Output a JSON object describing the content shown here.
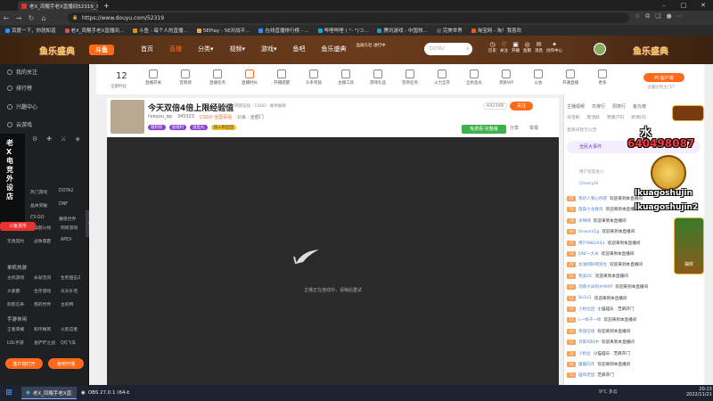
{
  "browser": {
    "tabs": [
      {
        "label": "老X_凤鲲手老X直播间52319_斗鱼"
      },
      {
        "label": "新标签页"
      }
    ],
    "url": "https://www.douyu.com/52319",
    "bookmarks": [
      "百度一下，你就知道",
      "老X_凤鲲手老X直播间...",
      "斗鱼 - 每个人的直播...",
      "5EPlay - 5E对战平...",
      "在线直播排行榜 - ...",
      "哔哩哔哩 ( °- °)つ...",
      "腾讯游戏 - 中国领...",
      "完美世界",
      "淘宝网 - 淘！我喜欢"
    ]
  },
  "site": {
    "logo_left": "鱼乐盛典",
    "logo_right": "鱼乐盛典",
    "brand": "斗鱼",
    "nav": [
      "首页",
      "直播",
      "分类▾",
      "视频▾",
      "游戏▾",
      "鱼吧",
      "鱼乐盛典"
    ],
    "promo": "品质礼社 进行中",
    "search_placeholder": "DOTA2",
    "header_icons": [
      "历史",
      "关注",
      "开播",
      "鱼粮",
      "消息",
      "创作中心"
    ]
  },
  "sidebar": {
    "top": [
      "我的关注",
      "排行榜",
      "兴趣中心",
      "云游戏"
    ],
    "hot_games": [
      "热门游戏",
      "DOTA2",
      "晶体突破",
      "DNF",
      "CS:GO",
      "魔兽世界",
      "英雄联盟",
      "穿越火线",
      "网易游戏",
      "无畏契约",
      "战争雷霆",
      "APEX"
    ],
    "single_title": "单机热游",
    "single": [
      "主机游戏",
      "永劫无间",
      "生死狙击2",
      "大家都",
      "生存游戏",
      "天天扑克",
      "刺客信条",
      "我的世界",
      "主机鸭"
    ],
    "mobile_title": "手游休闲",
    "mobile": [
      "王者荣耀",
      "和平精英",
      "火影忍者",
      "LOL手游",
      "金铲铲之战",
      "QQ飞车"
    ],
    "btn_left": "客户端打开",
    "btn_right": "鱼吧开播"
  },
  "categories": {
    "count": "12",
    "count_label": "全部时段",
    "items": [
      "直播开关",
      "音频源",
      "直播任务",
      "直播时长",
      "开播提醒",
      "头条奖励",
      "主播工具",
      "游戏礼品",
      "签到任务",
      "商城",
      "火力全开",
      "全民鱼丸",
      "贵族VIP",
      "公会",
      "开通直播",
      "更多"
    ],
    "pc_btn": "PC客户端",
    "pc_sub": "主播达到主门户"
  },
  "room": {
    "title": "今天双倍4倍上限经验值",
    "tags": "单机 · 网游竞技 · CSGO · 被举报榜",
    "streamer": "liveyou_qq",
    "followers": "345323",
    "fans_badge": "CSGO 全国百强",
    "notice": "公会 · 全部门",
    "view_btn": "分享",
    "report": "举报",
    "hot": "642348",
    "follow": "关注",
    "badges": [
      "福利机",
      "送福利",
      "送鱼丸",
      "加入粉丝团"
    ],
    "sub_btn": "免费看·完整版",
    "offline": "主播正在连线中，请稍后重试"
  },
  "chat": {
    "tabs": [
      "主播视频",
      "日排行",
      "周排行",
      "鱼丸榜",
      "贡献"
    ],
    "rank_tabs": [
      "日活跃",
      "周活跃",
      "贵族(70)",
      "新增(0)"
    ],
    "notice_label": "直播间暂无公告",
    "event_label": "全民大事件",
    "system": "用户欢迎进入",
    "welcome_user": "Cheery.hl",
    "lines": [
      {
        "lvl": "23",
        "user": "我的人我心所欲",
        "msg": "欢迎来到本直播间"
      },
      {
        "lvl": "16",
        "user": "陌森小龙春风",
        "msg": "欢迎来到本直播间"
      },
      {
        "lvl": "18",
        "user": "沐晴晴",
        "msg": "欢迎来到本直播间"
      },
      {
        "lvl": "16",
        "user": "forward1g",
        "msg": "欢迎来到本直播间"
      },
      {
        "lvl": "15",
        "user": "用户9882442",
        "msg": "欢迎来到本直播间"
      },
      {
        "lvl": "19",
        "user": "DNF~大米",
        "msg": "欢迎来到本直播间"
      },
      {
        "lvl": "21",
        "user": "加油啊好啊男生",
        "msg": "欢迎来到本直播间"
      },
      {
        "lvl": "12",
        "user": "我爱DC",
        "msg": "欢迎来到本直播间"
      },
      {
        "lvl": "14",
        "user": "饶愿大米莉#999P",
        "msg": "欢迎来到本直播间"
      },
      {
        "lvl": "11",
        "user": "Bu1a1",
        "msg": "欢迎来到本直播间"
      },
      {
        "lvl": "17",
        "user": "小粉丝团",
        "msg": "小猫喵乐 · 芝麻开门"
      },
      {
        "lvl": "13",
        "user": "L一样子一样",
        "msg": "欢迎来到本直播间"
      },
      {
        "lvl": "16",
        "user": "英雄在线",
        "msg": "欢迎来到本直播间"
      },
      {
        "lvl": "12",
        "user": "邻家扫码中",
        "msg": "欢迎来到本直播间"
      },
      {
        "lvl": "15",
        "user": "小粉丝",
        "msg": "小猫喵乐 · 芝麻开门"
      },
      {
        "lvl": "14",
        "user": "暖暖的花",
        "msg": "欢迎来到本直播间"
      },
      {
        "lvl": "13",
        "user": "猫和老鼠",
        "msg": "芝麻开门"
      }
    ]
  },
  "overlay": {
    "left_text": "老X电竞外设店",
    "left_badge": "斗鱼货币",
    "watermark_top": "水",
    "number": "640498087",
    "ad1": "lkuagoshujin",
    "ad2": "lkuagoshujin2",
    "gift": "抽奖"
  },
  "taskbar": {
    "items": [
      "老X_凤鲲手老X直播间...",
      "OBS 27.0.1 (64-bi..."
    ],
    "time": "20:13",
    "date": "2022/11/21",
    "weather": "9°C 多云"
  }
}
